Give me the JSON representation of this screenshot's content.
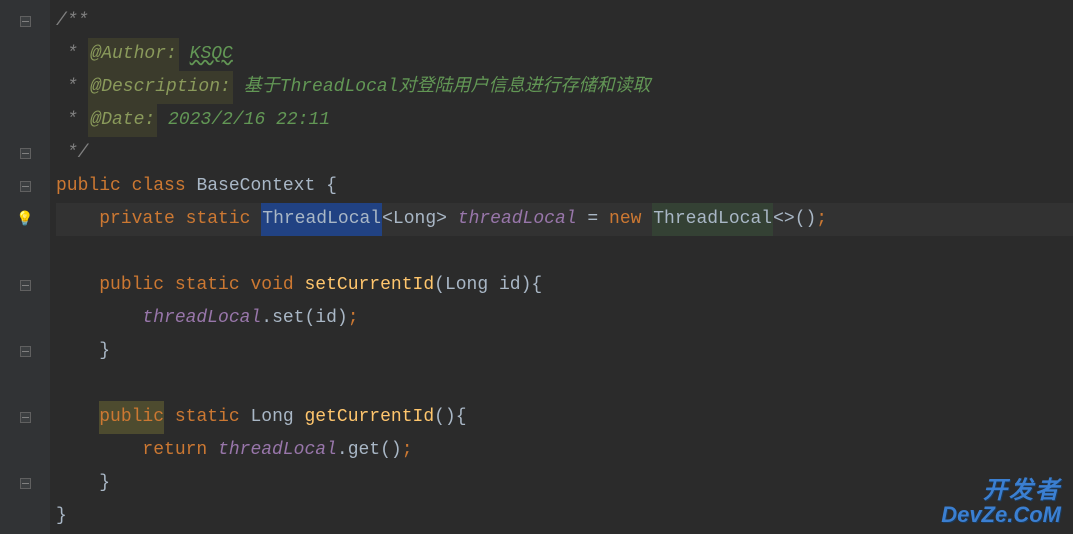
{
  "gutter": {
    "bulb": "💡"
  },
  "code": {
    "l1": {
      "c1": "/**"
    },
    "l2": {
      "c1": " * ",
      "tag": "@Author:",
      "c2": " ",
      "val": "KSQC"
    },
    "l3": {
      "c1": " * ",
      "tag": "@Description:",
      "c2": " ",
      "val": "基于ThreadLocal对登陆用户信息进行存储和读取"
    },
    "l4": {
      "c1": " * ",
      "tag": "@Date:",
      "c2": " ",
      "val": "2023/2/16 22:11"
    },
    "l5": {
      "c1": " */"
    },
    "l6": {
      "k1": "public",
      "sp1": " ",
      "k2": "class",
      "sp2": " ",
      "name": "BaseContext",
      "sp3": " ",
      "brace": "{"
    },
    "l7": {
      "indent": "    ",
      "k1": "private",
      "sp1": " ",
      "k2": "static",
      "sp2": " ",
      "type1": "ThreadLocal",
      "lt": "<",
      "type2": "Long",
      "gt": ">",
      "sp3": " ",
      "field": "threadLocal",
      "sp4": " ",
      "eq": "=",
      "sp5": " ",
      "k3": "new",
      "sp6": " ",
      "type3": "ThreadLocal",
      "diamond": "<>",
      "paren": "()",
      "semi": ";"
    },
    "l8": {
      "blank": ""
    },
    "l9": {
      "indent": "    ",
      "k1": "public",
      "sp1": " ",
      "k2": "static",
      "sp2": " ",
      "k3": "void",
      "sp3": " ",
      "method": "setCurrentId",
      "lp": "(",
      "ptype": "Long",
      "sp4": " ",
      "pname": "id",
      "rp": ")",
      "brace": "{"
    },
    "l10": {
      "indent": "        ",
      "field": "threadLocal",
      "dot": ".",
      "method": "set",
      "lp": "(",
      "arg": "id",
      "rp": ")",
      "semi": ";"
    },
    "l11": {
      "indent": "    ",
      "brace": "}"
    },
    "l12": {
      "blank": ""
    },
    "l13": {
      "indent": "    ",
      "k1": "public",
      "sp1": " ",
      "k2": "static",
      "sp2": " ",
      "type": "Long",
      "sp3": " ",
      "method": "getCurrentId",
      "paren": "()",
      "brace": "{"
    },
    "l14": {
      "indent": "        ",
      "k1": "return",
      "sp1": " ",
      "field": "threadLocal",
      "dot": ".",
      "method": "get",
      "paren": "()",
      "semi": ";"
    },
    "l15": {
      "indent": "    ",
      "brace": "}"
    },
    "l16": {
      "brace": "}"
    }
  },
  "watermark": {
    "top": "开发者",
    "bot": "DevZe.CoM"
  }
}
